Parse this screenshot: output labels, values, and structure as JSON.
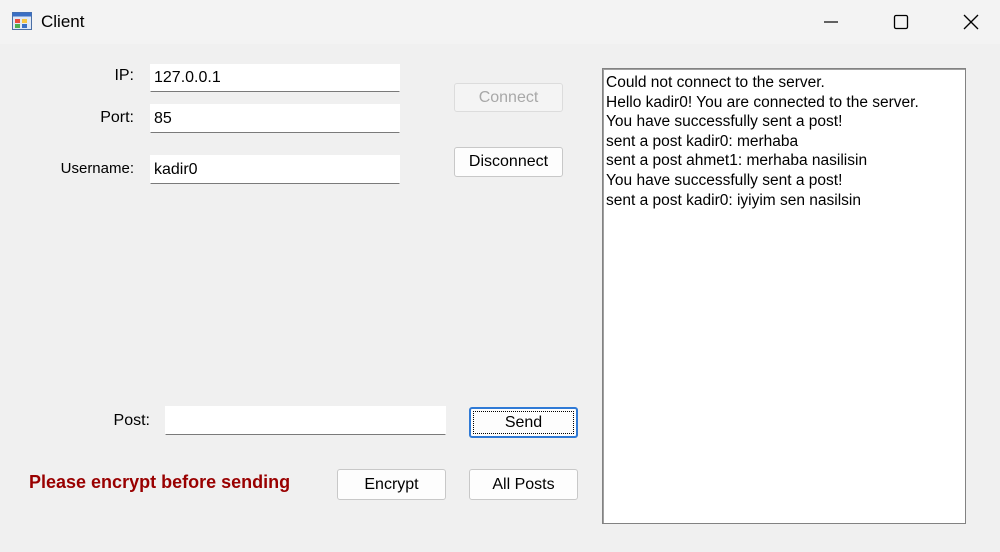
{
  "window": {
    "title": "Client",
    "icon": "app-window-icon"
  },
  "form": {
    "ip_label": "IP:",
    "ip_value": "127.0.0.1",
    "port_label": "Port:",
    "port_value": "85",
    "username_label": "Username:",
    "username_value": "kadir0",
    "post_label": "Post:",
    "post_value": ""
  },
  "buttons": {
    "connect": "Connect",
    "disconnect": "Disconnect",
    "send": "Send",
    "encrypt": "Encrypt",
    "all_posts": "All Posts"
  },
  "warning": "Please encrypt before sending",
  "log": [
    "Could not connect to the server.",
    "Hello kadir0! You are connected to the server.",
    "You have successfully sent a post!",
    "sent a post kadir0: merhaba",
    "sent a post ahmet1: merhaba nasilisin",
    "You have successfully sent a post!",
    "sent a post kadir0: iyiyim sen nasilsin"
  ],
  "colors": {
    "warning": "#990000",
    "focus": "#2f7ad6"
  }
}
